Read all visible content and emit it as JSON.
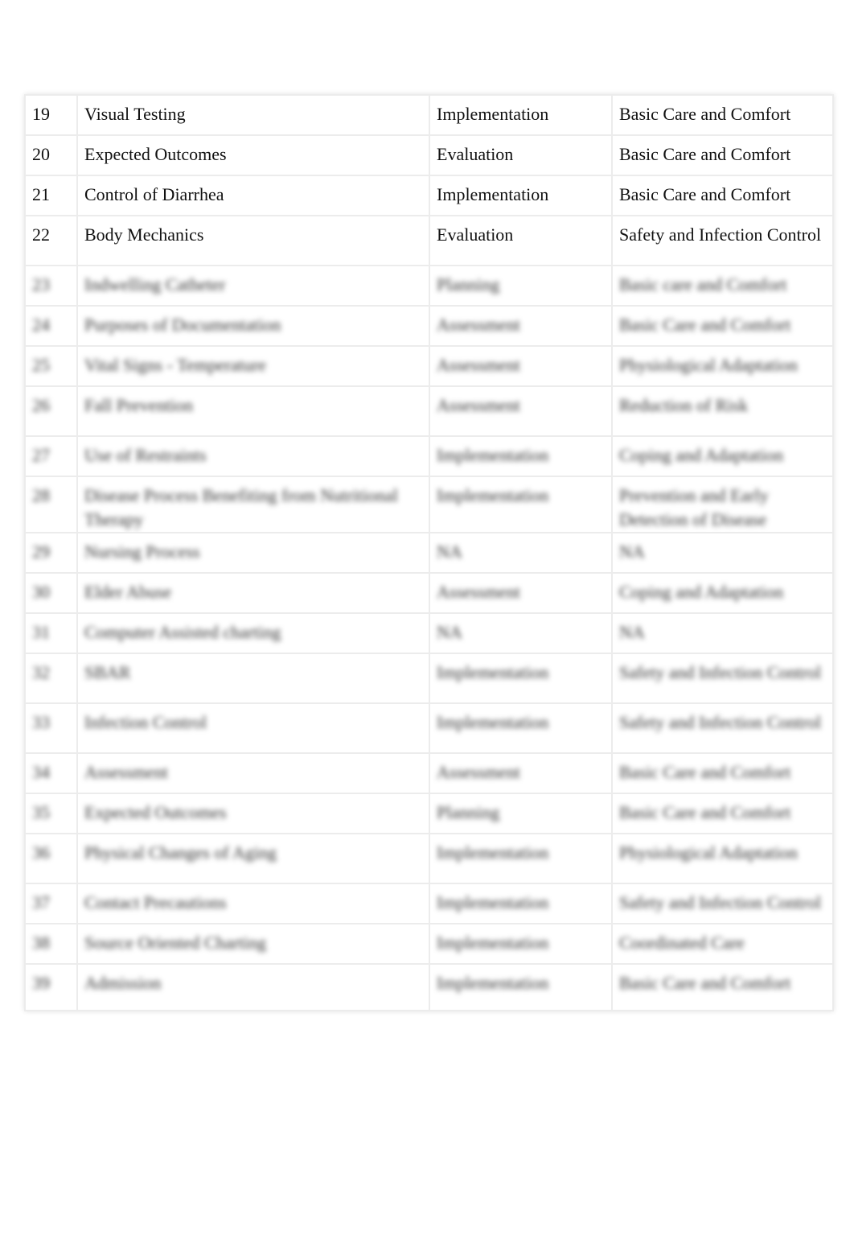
{
  "table": {
    "rows": [
      {
        "num": "19",
        "topic": "Visual Testing",
        "step": "Implementation",
        "category": "Basic Care and Comfort"
      },
      {
        "num": "20",
        "topic": "Expected Outcomes",
        "step": "Evaluation",
        "category": "Basic Care and Comfort"
      },
      {
        "num": "21",
        "topic": "Control of Diarrhea",
        "step": "Implementation",
        "category": "Basic Care and Comfort"
      },
      {
        "num": "22",
        "topic": "Body Mechanics",
        "step": "Evaluation",
        "category": "Safety and Infection Control"
      },
      {
        "num": "23",
        "topic": "Indwelling Catheter",
        "step": "Planning",
        "category": "Basic care and Comfort"
      },
      {
        "num": "24",
        "topic": "Purposes of Documentation",
        "step": "Assessment",
        "category": "Basic Care and Comfort"
      },
      {
        "num": "25",
        "topic": "Vital Signs - Temperature",
        "step": "Assessment",
        "category": "Physiological Adaptation"
      },
      {
        "num": "26",
        "topic": "Fall Prevention",
        "step": "Assessment",
        "category": "Reduction of Risk"
      },
      {
        "num": "27",
        "topic": "Use of Restraints",
        "step": "Implementation",
        "category": "Coping and Adaptation"
      },
      {
        "num": "28",
        "topic": "Disease Process Benefiting from Nutritional Therapy",
        "step": "Implementation",
        "category": "Prevention and Early Detection of Disease"
      },
      {
        "num": "29",
        "topic": "Nursing Process",
        "step": "NA",
        "category": "NA"
      },
      {
        "num": "30",
        "topic": "Elder Abuse",
        "step": "Assessment",
        "category": "Coping and Adaptation"
      },
      {
        "num": "31",
        "topic": "Computer Assisted charting",
        "step": "NA",
        "category": "NA"
      },
      {
        "num": "32",
        "topic": "SBAR",
        "step": "Implementation",
        "category": "Safety and Infection Control"
      },
      {
        "num": "33",
        "topic": "Infection Control",
        "step": "Implementation",
        "category": "Safety and Infection Control"
      },
      {
        "num": "34",
        "topic": "Assessment",
        "step": "Assessment",
        "category": "Basic Care and Comfort"
      },
      {
        "num": "35",
        "topic": "Expected Outcomes",
        "step": "Planning",
        "category": "Basic Care and Comfort"
      },
      {
        "num": "36",
        "topic": "Physical Changes of Aging",
        "step": "Implementation",
        "category": "Physiological Adaptation"
      },
      {
        "num": "37",
        "topic": "Contact Precautions",
        "step": "Implementation",
        "category": "Safety and Infection Control"
      },
      {
        "num": "38",
        "topic": "Source Oriented Charting",
        "step": "Implementation",
        "category": "Coordinated Care"
      },
      {
        "num": "39",
        "topic": "Admission",
        "step": "Implementation",
        "category": "Basic Care and Comfort"
      }
    ]
  }
}
